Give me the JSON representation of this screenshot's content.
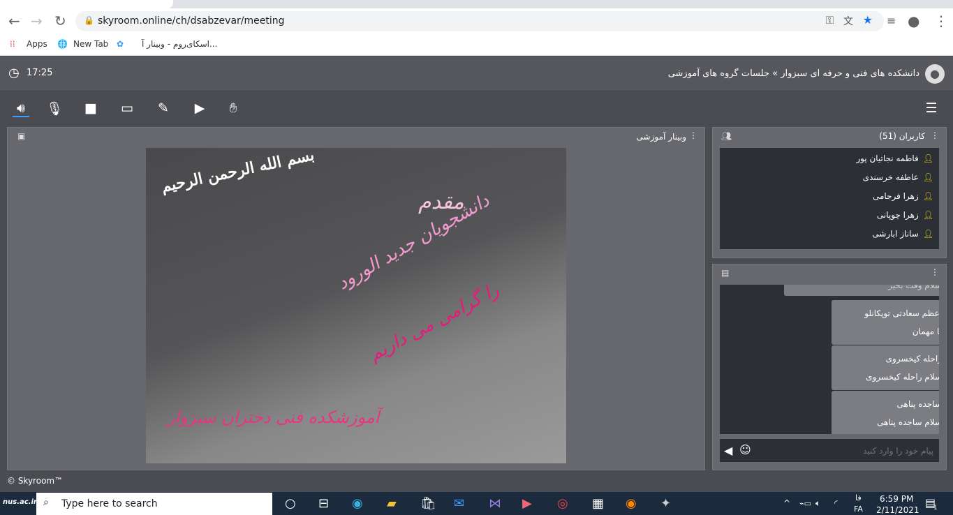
{
  "browser": {
    "url": "skyroom.online/ch/dsabzevar/meeting",
    "bookmarks": [
      "Apps",
      "New Tab",
      "اسکای‌روم - وبینار آ..."
    ]
  },
  "header": {
    "time": "17:25",
    "title": "دانشکده های فنی و حرفه ای سبزوار » جلسات گروه های آموزشی"
  },
  "toolbar": {
    "icons": [
      "speaker-icon",
      "mic-off-icon",
      "camera-icon",
      "screen-share-icon",
      "whiteboard-icon",
      "play-icon",
      "hand-icon",
      "menu-icon"
    ]
  },
  "main": {
    "title": "وبینار آموزشی",
    "slide": {
      "basmala": "بسم الله الرحمن الرحیم",
      "line1": "مقدم",
      "line2": "دانشجویان جدید الورود",
      "line3": "را گرامی می داریم",
      "line4": "آموزشکده فنی دختران سبزوار"
    }
  },
  "users": {
    "title": "کاربران (51)",
    "list": [
      "فاطمه نجاتیان پور",
      "عاطفه خرسندی",
      "زهرا فرجامی",
      "زهرا چوپانی",
      "ساناز ابارشی"
    ]
  },
  "chat": {
    "partial": "سلام وقت بخیر",
    "messages": [
      {
        "name": "اعظم سعادتی توپکانلو",
        "text": "با مهمان"
      },
      {
        "name": "راحله کیخسروی",
        "text": "سلام راحله کیخسروی"
      },
      {
        "name": "ساجده پناهی",
        "text": "سلام ساجده پناهی"
      }
    ],
    "placeholder": "پیام خود را وارد کنید"
  },
  "footer": "© Skyroom™",
  "taskbar": {
    "search": "Type here to search",
    "lang1": "فا",
    "lang2": "FA",
    "time": "6:59 PM",
    "date": "2/11/2021",
    "notif": "1",
    "watermark": "nus.ac.ir"
  }
}
